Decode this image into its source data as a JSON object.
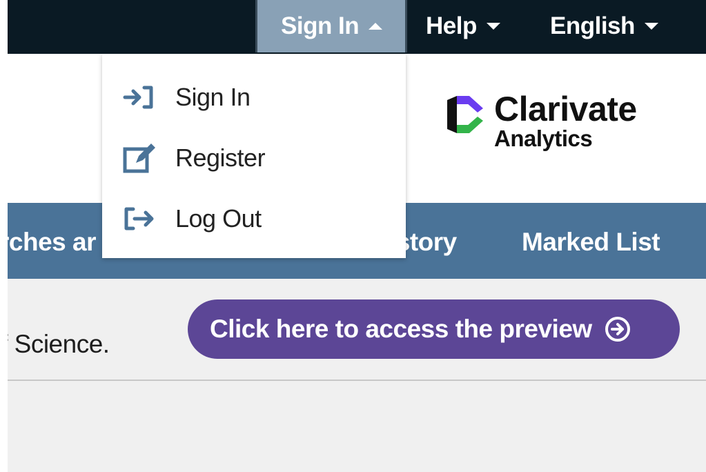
{
  "topbar": {
    "sign_in_label": "Sign In",
    "help_label": "Help",
    "language_label": "English"
  },
  "dropdown": {
    "items": [
      {
        "label": "Sign In",
        "icon": "sign-in-icon"
      },
      {
        "label": "Register",
        "icon": "edit-icon"
      },
      {
        "label": "Log Out",
        "icon": "log-out-icon"
      }
    ]
  },
  "logo": {
    "name": "Clarivate",
    "sub": "Analytics"
  },
  "nav": {
    "searches_label": "rches ar",
    "history_label": "istory",
    "marked_list_label": "Marked List"
  },
  "notice": {
    "text": "of Science.",
    "button_label": "Click here to access the preview"
  },
  "colors": {
    "topbar_bg": "#0a1a24",
    "active_tab": "#89a1b6",
    "nav_bg": "#4a7398",
    "accent_purple": "#5c4696",
    "icon_blue": "#4a7398"
  }
}
